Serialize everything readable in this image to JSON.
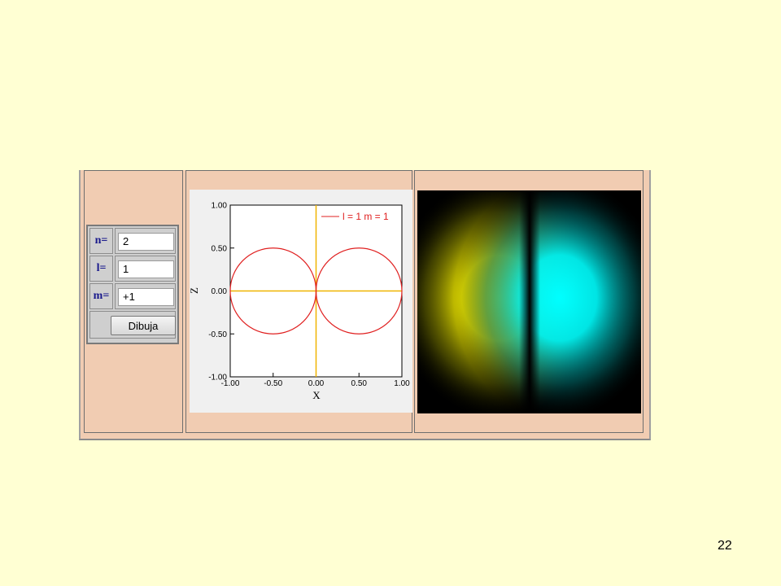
{
  "form": {
    "n_label": "n=",
    "n_value": "2",
    "l_label": "l=",
    "l_value": "1",
    "m_label": "m=",
    "m_value": "+1",
    "draw_button": "Dibuja"
  },
  "chart_data": {
    "type": "line",
    "xlabel": "X",
    "ylabel": "Z",
    "xlim": [
      -1.0,
      1.0
    ],
    "ylim": [
      -1.0,
      1.0
    ],
    "x_ticks": [
      "-1.00",
      "-0.50",
      "0.00",
      "0.50",
      "1.00"
    ],
    "y_ticks": [
      "1.00",
      "0.50",
      "0.00",
      "-0.50",
      "-1.00"
    ],
    "legend": "top-right",
    "grid": false,
    "series": [
      {
        "name": "l = 1 m = 1",
        "shape": "polar r = |sin(theta)| (two tangent circles)",
        "centers": [
          [
            -0.5,
            0
          ],
          [
            0.5,
            0
          ]
        ],
        "radius": 0.5
      }
    ],
    "axis_lines_color": "#f0b400",
    "series_color": "#e02020"
  },
  "orbital_image": {
    "left_lobe_color": "#ffff00",
    "right_lobe_color": "#00ffff",
    "background": "#000000"
  },
  "slide": {
    "page_number": "22"
  }
}
